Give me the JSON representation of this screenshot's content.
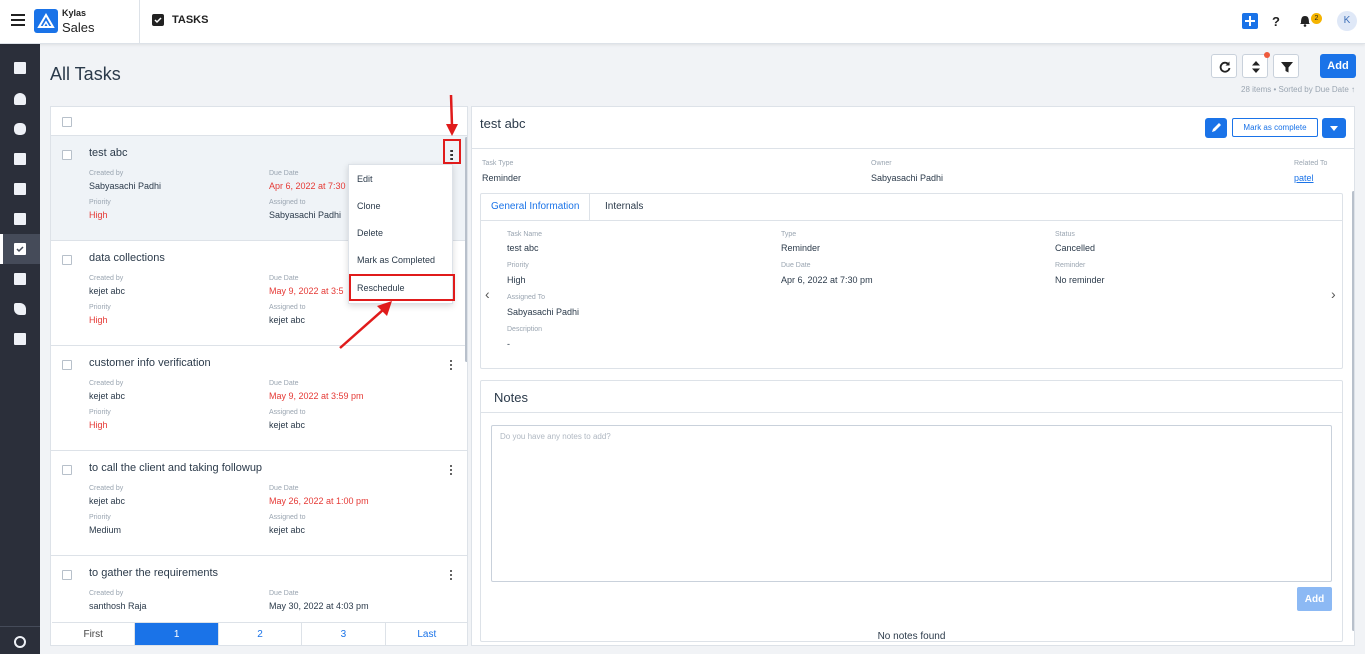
{
  "brand": {
    "top": "Kylas",
    "bottom": "Sales"
  },
  "module_title": "TASKS",
  "notification_count": "2",
  "user_initial": "K",
  "icons": [
    "menu-icon",
    "logo-icon",
    "tasks-check-icon",
    "add-icon",
    "help-icon",
    "bell-icon",
    "dashboard-icon",
    "contacts-icon",
    "deals-icon",
    "leads-icon",
    "companies-icon",
    "products-icon",
    "tasks-icon",
    "calendar-icon",
    "calls-icon",
    "reports-icon",
    "settings-icon",
    "refresh-icon",
    "sort-icon",
    "filter-icon",
    "kebab-icon",
    "edit-icon",
    "chevron-down-icon",
    "chevron-left-icon",
    "chevron-right-icon"
  ],
  "colors": {
    "accent": "#1a73e8",
    "danger": "#e53935",
    "sidebar": "#2b2f3a",
    "annotation": "#e01b1b"
  },
  "page": {
    "title": "All Tasks",
    "add_label": "Add",
    "count_text": "28 items • Sorted by Due Date ↑"
  },
  "labels": {
    "created_by": "Created by",
    "due_date": "Due Date",
    "priority": "Priority",
    "assigned_to": "Assigned to"
  },
  "tasks": [
    {
      "title": "test abc",
      "created_by": "Sabyasachi Padhi",
      "due": "Apr 6, 2022 at 7:30",
      "priority": "High",
      "assigned": "Sabyasachi Padhi"
    },
    {
      "title": "data collections",
      "created_by": "kejet abc",
      "due": "May 9, 2022 at 3:5",
      "priority": "High",
      "assigned": "kejet abc"
    },
    {
      "title": "customer info verification",
      "created_by": "kejet abc",
      "due": "May 9, 2022 at 3:59 pm",
      "priority": "High",
      "assigned": "kejet abc"
    },
    {
      "title": "to call the client and taking followup",
      "created_by": "kejet abc",
      "due": "May 26, 2022 at 1:00 pm",
      "priority": "Medium",
      "assigned": "kejet abc"
    },
    {
      "title": "to gather the requirements",
      "created_by": "santhosh Raja",
      "due": "May 30, 2022 at 4:03 pm",
      "priority": "",
      "assigned": ""
    }
  ],
  "menu": [
    "Edit",
    "Clone",
    "Delete",
    "Mark as Completed",
    "Reschedule"
  ],
  "pagination": [
    "First",
    "1",
    "2",
    "3",
    "Last"
  ],
  "detail": {
    "title": "test abc",
    "mark_complete_label": "Mark as complete",
    "header_fields": {
      "task_type_label": "Task Type",
      "task_type": "Reminder",
      "owner_label": "Owner",
      "owner": "Sabyasachi Padhi",
      "related_label": "Related To",
      "related": "patel"
    },
    "tabs": [
      "General Information",
      "Internals"
    ],
    "info": {
      "task_name_label": "Task Name",
      "task_name": "test abc",
      "type_label": "Type",
      "type": "Reminder",
      "status_label": "Status",
      "status": "Cancelled",
      "priority_label": "Priority",
      "priority": "High",
      "due_label": "Due Date",
      "due": "Apr 6, 2022 at 7:30 pm",
      "reminder_label": "Reminder",
      "reminder": "No reminder",
      "assigned_label": "Assigned To",
      "assigned": "Sabyasachi Padhi",
      "description_label": "Description",
      "description": "-"
    },
    "notes": {
      "title": "Notes",
      "placeholder": "Do you have any notes to add?",
      "add_label": "Add",
      "empty_text": "No notes found"
    }
  }
}
